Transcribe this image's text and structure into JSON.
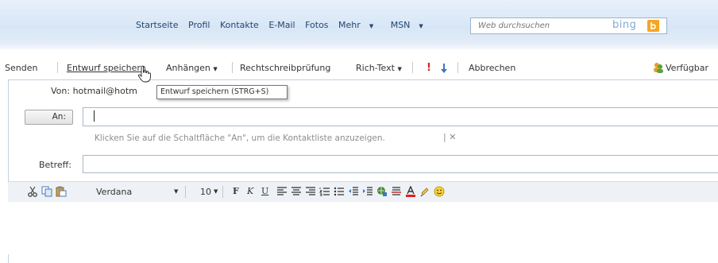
{
  "nav": {
    "links": [
      "Startseite",
      "Profil",
      "Kontakte",
      "E-Mail",
      "Fotos",
      "Mehr",
      "MSN"
    ],
    "search_placeholder": "Web durchsuchen",
    "search_brand": "bing"
  },
  "toolbar": {
    "send": "Senden",
    "save_draft": "Entwurf speichern",
    "attach": "Anhängen",
    "spellcheck": "Rechtschreibprüfung",
    "rich_text": "Rich-Text",
    "importance_high": "!",
    "cancel": "Abbrechen",
    "available": "Verfügbar"
  },
  "tooltip": {
    "text": "Entwurf speichern (STRG+S)"
  },
  "compose": {
    "from_label": "Von: hotmail@hotm",
    "to_button": "An:",
    "to_value": "",
    "hint": "Klicken Sie auf die Schaltfläche \"An\", um die Kontaktliste anzuzeigen.",
    "hint_separator": "|",
    "hint_close": "✕",
    "subject_label": "Betreff:",
    "subject_value": ""
  },
  "format": {
    "font": "Verdana",
    "size": "10",
    "bold": "F",
    "italic": "K",
    "underline": "U"
  },
  "colors": {
    "nav_text": "#26466f",
    "bing_orange": "#f5a623",
    "importance_red": "#e02020",
    "accent_blue": "#3a78c2"
  }
}
